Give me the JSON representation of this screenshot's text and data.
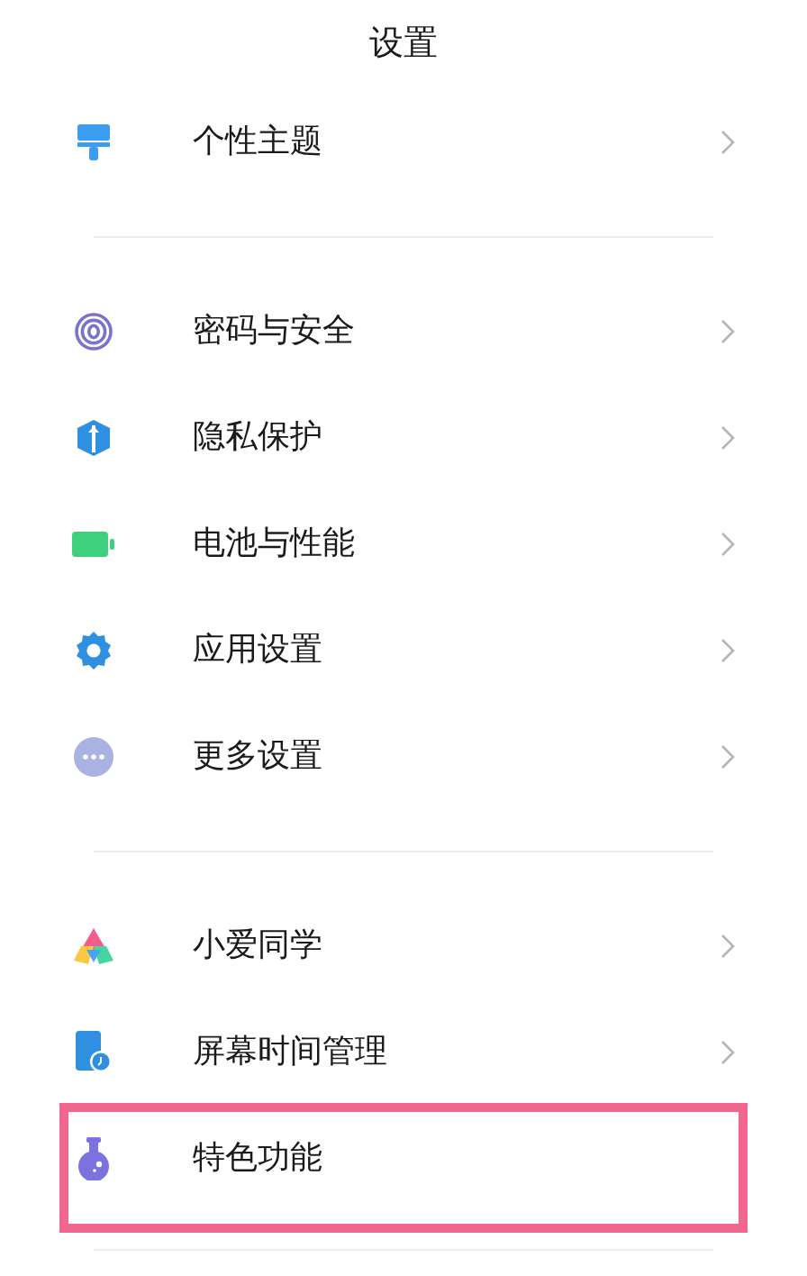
{
  "title": "设置",
  "groups": [
    {
      "items": [
        {
          "label": "个性主题",
          "kind": "brush",
          "chevron": true,
          "highlighted": false
        }
      ]
    },
    {
      "items": [
        {
          "label": "密码与安全",
          "kind": "fingerprint",
          "chevron": true,
          "highlighted": false
        },
        {
          "label": "隐私保护",
          "kind": "shield",
          "chevron": true,
          "highlighted": false
        },
        {
          "label": "电池与性能",
          "kind": "battery",
          "chevron": true,
          "highlighted": false
        },
        {
          "label": "应用设置",
          "kind": "gear",
          "chevron": true,
          "highlighted": false
        },
        {
          "label": "更多设置",
          "kind": "more",
          "chevron": true,
          "highlighted": false
        }
      ]
    },
    {
      "items": [
        {
          "label": "小爱同学",
          "kind": "assistant",
          "chevron": true,
          "highlighted": false
        },
        {
          "label": "屏幕时间管理",
          "kind": "screen-time",
          "chevron": true,
          "highlighted": false
        },
        {
          "label": "特色功能",
          "kind": "flask",
          "chevron": false,
          "highlighted": true
        }
      ]
    }
  ]
}
